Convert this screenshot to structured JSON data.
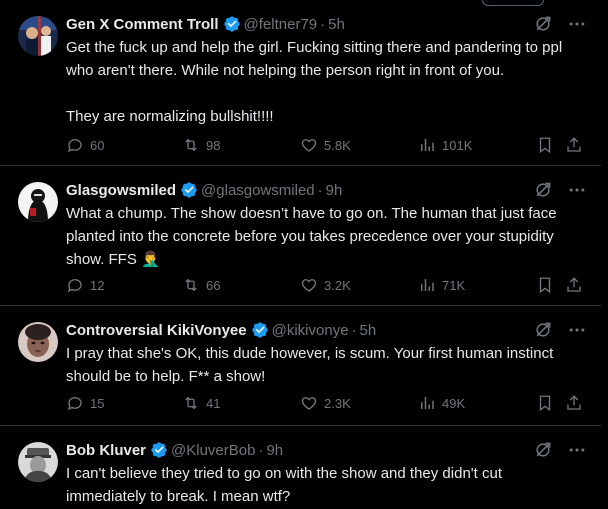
{
  "tweets": [
    {
      "name": "Gen X Comment Troll",
      "handle": "@feltner79",
      "time": "5h",
      "text": "Get the fuck up and help the girl. Fucking sitting there and pandering to ppl who aren't there. While not helping the person right in front of you.\n\nThey are normalizing bullshit!!!!",
      "replies": "60",
      "retweets": "98",
      "likes": "5.8K",
      "views": "101K"
    },
    {
      "name": "Glasgowsmiled",
      "handle": "@glasgowsmiled",
      "time": "9h",
      "text": "What a chump. The show doesn’t have to go on. The human that just face planted into the concrete before you takes precedence over your stupidity show. FFS 🤦‍♂️",
      "replies": "12",
      "retweets": "66",
      "likes": "3.2K",
      "views": "71K"
    },
    {
      "name": "Controversial KikiVonyee",
      "handle": "@kikivonye",
      "time": "5h",
      "text": "I pray that she's OK, this dude however, is scum. Your first human instinct should be to help. F** a show!",
      "replies": "15",
      "retweets": "41",
      "likes": "2.3K",
      "views": "49K"
    },
    {
      "name": "Bob Kluver",
      "handle": "@KluverBob",
      "time": "9h",
      "text": "I can't believe they tried to go on with the show and they didn't cut immediately to break. I mean wtf?"
    }
  ],
  "colors": {
    "background": "#000000",
    "text": "#e7e9ea",
    "muted": "#71767b",
    "divider": "#2f3336",
    "verified": "#1d9bf0"
  },
  "icons": [
    "verified-badge-icon",
    "grok-icon",
    "more-icon",
    "reply-icon",
    "retweet-icon",
    "like-icon",
    "views-icon",
    "bookmark-icon",
    "share-icon"
  ]
}
